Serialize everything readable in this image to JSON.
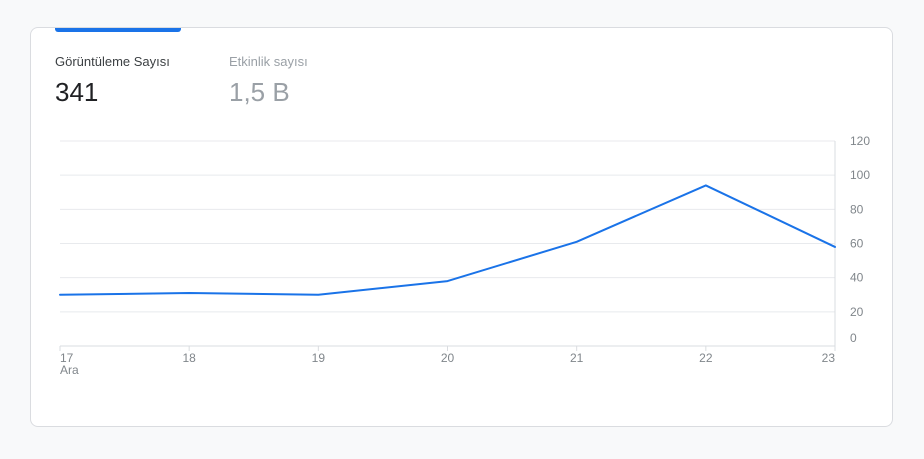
{
  "metrics": [
    {
      "label": "Görüntüleme Sayısı",
      "value": "341",
      "active": true
    },
    {
      "label": "Etkinlik sayısı",
      "value": "1,5 B",
      "active": false
    }
  ],
  "colors": {
    "accent": "#1a73e8",
    "line": "#1a73e8",
    "grid": "#e8eaed",
    "muted_text": "#9aa0a6",
    "axis_text": "#80868b"
  },
  "chart_data": {
    "type": "line",
    "x": [
      "17",
      "18",
      "19",
      "20",
      "21",
      "22",
      "23"
    ],
    "x_sublabel": "Ara",
    "series": [
      {
        "values": [
          30,
          31,
          30,
          38,
          61,
          94,
          58
        ]
      }
    ],
    "yticks": [
      0,
      20,
      40,
      60,
      80,
      100,
      120
    ],
    "ylim": [
      0,
      120
    ],
    "y_axis_side": "right",
    "grid": true
  }
}
